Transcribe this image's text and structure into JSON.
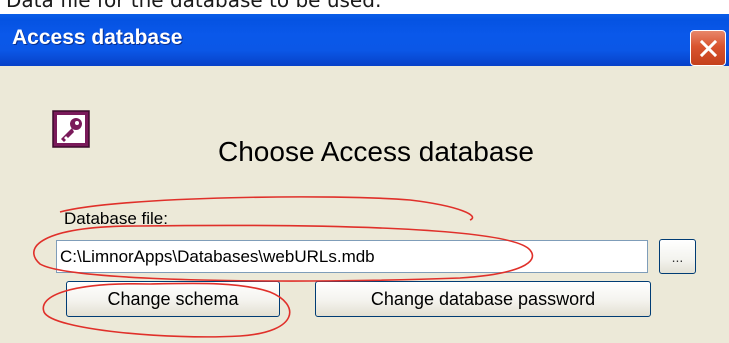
{
  "top_strip": {
    "text": "Data file for the database to be used:"
  },
  "window": {
    "title": "Access database",
    "close_icon": "close-icon"
  },
  "dialog": {
    "icon": "access-key-icon",
    "heading": "Choose Access database",
    "file_label": "Database file:",
    "file_value": "C:\\LimnorApps\\Databases\\webURLs.mdb",
    "browse_label": "...",
    "change_schema_label": "Change schema",
    "change_password_label": "Change database password"
  },
  "annotation_color": "#e0302a",
  "colors": {
    "titlebar": "#0a58ea",
    "dialog_bg": "#ece9d8",
    "access_icon": "#7a1a5a"
  }
}
